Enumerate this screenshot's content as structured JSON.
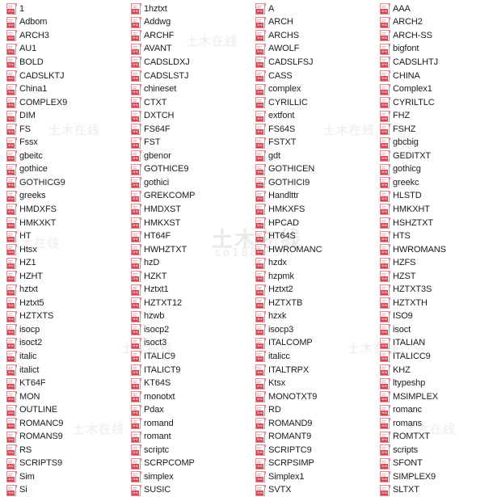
{
  "window": {
    "title": "Font File List",
    "icon_badge_text": "SHX",
    "icon_name": "shx-font-file-icon"
  },
  "watermark": {
    "line_main": "土木在线",
    "line_sub": "co188.com",
    "tile_text": "土木在线"
  },
  "columns": [
    {
      "name": "column-1",
      "items": [
        "1",
        "Adbom",
        "ARCH3",
        "AU1",
        "BOLD",
        "CADSLKTJ",
        "China1",
        "COMPLEX9",
        "DIM",
        "FS",
        "Fssx",
        "gbeitc",
        "gothice",
        "GOTHICG9",
        "greeks",
        "HMDXFS",
        "HMKXKT",
        "HT",
        "Htsx",
        "HZ1",
        "HZHT",
        "hztxt",
        "Hztxt5",
        "HZTXTS",
        "isocp",
        "isoct2",
        "italic",
        "italict",
        "KT64F",
        "MON",
        "OUTLINE",
        "ROMANC9",
        "ROMANS9",
        "RS",
        "SCRIPTS9",
        "Sim",
        "Si"
      ]
    },
    {
      "name": "column-2",
      "items": [
        "1hztxt",
        "Addwg",
        "ARCHF",
        "AVANT",
        "CADSLDXJ",
        "CADSLSTJ",
        "chineset",
        "CTXT",
        "DXTCH",
        "FS64F",
        "FST",
        "gbenor",
        "GOTHICE9",
        "gothici",
        "GREKCOMP",
        "HMDXST",
        "HMKXST",
        "HT64F",
        "HWHZTXT",
        "hzD",
        "HZKT",
        "Hztxt1",
        "HZTXT12",
        "hzwb",
        "isocp2",
        "isoct3",
        "ITALIC9",
        "ITALICT9",
        "KT64S",
        "monotxt",
        "Pdax",
        "romand",
        "romant",
        "scriptc",
        "SCRPCOMP",
        "simplex",
        "SUSIC"
      ]
    },
    {
      "name": "column-3",
      "items": [
        "A",
        "ARCH",
        "ARCHS",
        "AWOLF",
        "CADSLFSJ",
        "CASS",
        "complex",
        "CYRILLIC",
        "extfont",
        "FS64S",
        "FSTXT",
        "gdt",
        "GOTHICEN",
        "GOTHICI9",
        "Handlttr",
        "HMKXFS",
        "HPCAD",
        "HT64S",
        "HWROMANC",
        "hzdx",
        "hzpmk",
        "Hztxt2",
        "HZTXTB",
        "hzxk",
        "isocp3",
        "ITALCOMP",
        "italicc",
        "ITALTRPX",
        "Ktsx",
        "MONOTXT9",
        "RD",
        "ROMAND9",
        "ROMANT9",
        "SCRIPTC9",
        "SCRPSIMP",
        "Simplex1",
        "SVTX"
      ]
    },
    {
      "name": "column-4",
      "items": [
        "AAA",
        "ARCH2",
        "ARCH-SS",
        "bigfont",
        "CADSLHTJ",
        "CHINA",
        "Complex1",
        "CYRILTLC",
        "FHZ",
        "FSHZ",
        "gbcbig",
        "GEDITXT",
        "gothicg",
        "greekc",
        "HLSTD",
        "HMKXHT",
        "HSHZTXT",
        "HTS",
        "HWROMANS",
        "HZFS",
        "HZST",
        "HZTXT3S",
        "HZTXTH",
        "ISO9",
        "isoct",
        "ITALIAN",
        "ITALICC9",
        "KHZ",
        "ltypeshp",
        "MSIMPLEX",
        "romanc",
        "romans",
        "ROMTXT",
        "scripts",
        "SFONT",
        "SIMPLEX9",
        "SLTXT"
      ]
    }
  ],
  "colors": {
    "icon_border": "#e08a93",
    "icon_badge": "#d9434f",
    "text": "#1b1b1b",
    "background": "#ffffff",
    "watermark": "#e9e9e9"
  }
}
